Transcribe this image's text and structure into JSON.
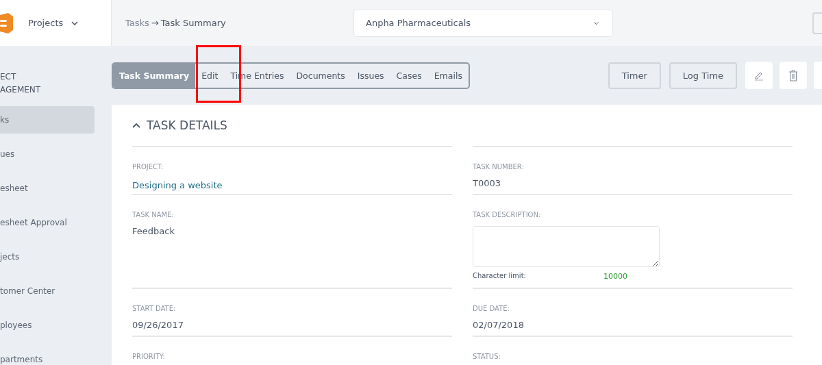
{
  "header": {
    "app_menu": "Projects",
    "breadcrumb": {
      "parent": "Tasks",
      "separator": "→",
      "current": "Task Summary"
    },
    "company_select": {
      "value": "Anpha Pharmaceuticals"
    }
  },
  "sidebar": {
    "section_title": [
      "ECT",
      "AGEMENT"
    ],
    "items": [
      {
        "label": "ks",
        "selected": true
      },
      {
        "label": "ues",
        "selected": false
      },
      {
        "label": "esheet",
        "selected": false
      },
      {
        "label": "esheet Approval",
        "selected": false
      },
      {
        "label": "jects",
        "selected": false
      },
      {
        "label": "tomer Center",
        "selected": false
      },
      {
        "label": "ployees",
        "selected": false
      },
      {
        "label": "partments",
        "selected": false
      }
    ]
  },
  "tabs": [
    {
      "label": "Task Summary",
      "selected": true
    },
    {
      "label": "Edit",
      "selected": false
    },
    {
      "label": "Time Entries",
      "selected": false
    },
    {
      "label": "Documents",
      "selected": false
    },
    {
      "label": "Issues",
      "selected": false
    },
    {
      "label": "Cases",
      "selected": false
    },
    {
      "label": "Emails",
      "selected": false
    }
  ],
  "actions": [
    "Timer",
    "Log Time"
  ],
  "task_details": {
    "title": "TASK DETAILS",
    "expanded": true,
    "fields": [
      {
        "kind": "link",
        "label": "PROJECT:",
        "value": "Designing a website"
      },
      {
        "kind": "text",
        "label": "TASK NUMBER:",
        "value": "T0003"
      },
      {
        "kind": "text",
        "label": "TASK NAME:",
        "value": "Feedback"
      },
      {
        "kind": "textarea",
        "label": "TASK DESCRIPTION:",
        "limit_label": "Character limit:",
        "limit": "10000"
      },
      {
        "kind": "text",
        "label": "START DATE:",
        "value": "09/26/2017"
      },
      {
        "kind": "text",
        "label": "DUE DATE:",
        "value": "02/07/2018"
      },
      {
        "kind": "text",
        "label": "PRIORITY:"
      },
      {
        "kind": "text",
        "label": "STATUS:"
      }
    ]
  }
}
